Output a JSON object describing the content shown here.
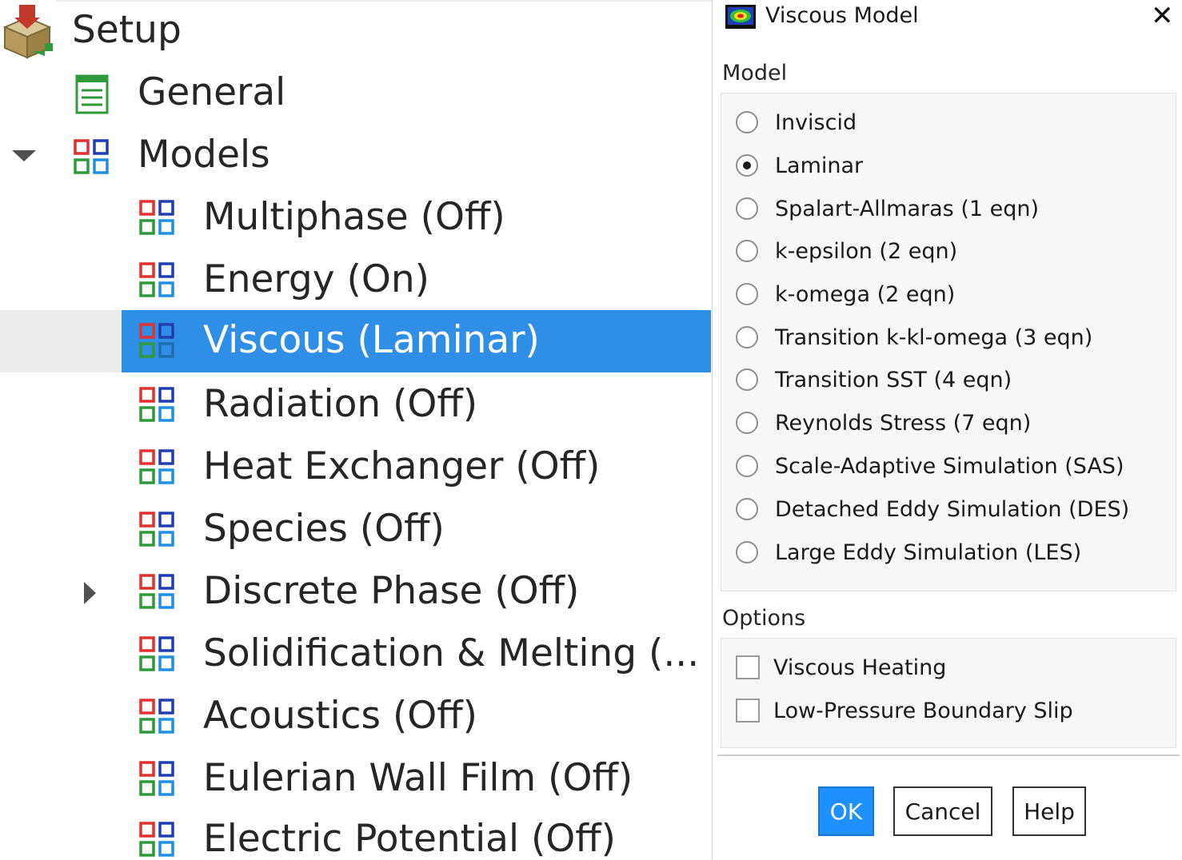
{
  "tree": {
    "root": {
      "label": "Setup",
      "icon": "setup-icon"
    },
    "items": [
      {
        "label": "General",
        "icon": "general-icon"
      },
      {
        "label": "Models",
        "icon": "models-icon",
        "expanded": true
      },
      {
        "label": "Multiphase (Off)",
        "icon": "model-icon"
      },
      {
        "label": "Energy (On)",
        "icon": "model-icon"
      },
      {
        "label": "Viscous (Laminar)",
        "icon": "model-icon",
        "selected": true
      },
      {
        "label": "Radiation (Off)",
        "icon": "model-icon"
      },
      {
        "label": "Heat Exchanger (Off)",
        "icon": "model-icon"
      },
      {
        "label": "Species (Off)",
        "icon": "model-icon"
      },
      {
        "label": "Discrete Phase (Off)",
        "icon": "model-icon",
        "collapsed": true
      },
      {
        "label": "Solidification & Melting (...",
        "icon": "model-icon"
      },
      {
        "label": "Acoustics (Off)",
        "icon": "model-icon"
      },
      {
        "label": "Eulerian Wall Film (Off)",
        "icon": "model-icon"
      },
      {
        "label": "Electric Potential (Off)",
        "icon": "model-icon"
      }
    ]
  },
  "dialog": {
    "title": "Viscous Model",
    "close_icon": "close-icon",
    "model_section": "Model",
    "models": [
      {
        "label": "Inviscid",
        "checked": false
      },
      {
        "label": "Laminar",
        "checked": true
      },
      {
        "label": "Spalart-Allmaras (1 eqn)",
        "checked": false
      },
      {
        "label": "k-epsilon (2 eqn)",
        "checked": false
      },
      {
        "label": "k-omega (2 eqn)",
        "checked": false
      },
      {
        "label": "Transition k-kl-omega (3 eqn)",
        "checked": false
      },
      {
        "label": "Transition SST (4 eqn)",
        "checked": false
      },
      {
        "label": "Reynolds Stress (7 eqn)",
        "checked": false
      },
      {
        "label": "Scale-Adaptive Simulation (SAS)",
        "checked": false
      },
      {
        "label": "Detached Eddy Simulation (DES)",
        "checked": false
      },
      {
        "label": "Large Eddy Simulation (LES)",
        "checked": false
      }
    ],
    "options_section": "Options",
    "options": [
      {
        "label": "Viscous Heating",
        "checked": false
      },
      {
        "label": "Low-Pressure Boundary Slip",
        "checked": false
      }
    ],
    "buttons": {
      "ok": "OK",
      "cancel": "Cancel",
      "help": "Help"
    }
  },
  "colors": {
    "selection": "#2f8fe6",
    "primary_button": "#1e90ff",
    "icon_red": "#e03030",
    "icon_blue": "#1f3fb0",
    "icon_green": "#2f9a3a"
  }
}
